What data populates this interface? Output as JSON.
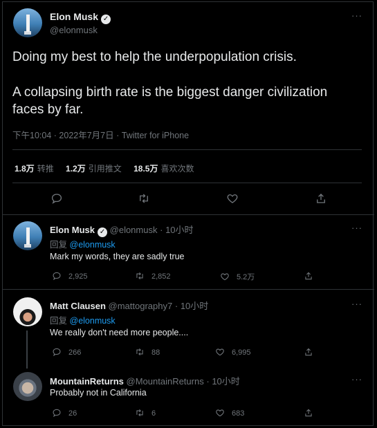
{
  "main_tweet": {
    "author_name": "Elon Musk",
    "author_handle": "@elonmusk",
    "text_line1": "Doing my best to help the underpopulation crisis.",
    "text_line2": "A collapsing birth rate is the biggest danger civilization",
    "text_line3": "faces by far.",
    "time": "下午10:04",
    "date": "2022年7月7日",
    "source": "Twitter for iPhone",
    "retweets_count": "1.8万",
    "retweets_label": "转推",
    "quotes_count": "1.2万",
    "quotes_label": "引用推文",
    "likes_count": "18.5万",
    "likes_label": "喜欢次数",
    "more": "···"
  },
  "replies": [
    {
      "name": "Elon Musk",
      "handle": "@elonmusk",
      "age": "10小时",
      "reply_prefix": "回复",
      "reply_to": "@elonmusk",
      "text": "Mark my words, they are sadly true",
      "replies": "2,925",
      "retweets": "2,852",
      "likes": "5.2万",
      "more": "···"
    },
    {
      "name": "Matt Clausen",
      "handle": "@mattography7",
      "age": "10小时",
      "reply_prefix": "回复",
      "reply_to": "@elonmusk",
      "text": "We really don't need more people....",
      "replies": "266",
      "retweets": "88",
      "likes": "6,995",
      "more": "···"
    },
    {
      "name": "MountainReturns",
      "handle": "@MountainReturns",
      "age": "10小时",
      "text": "Probably not in California",
      "replies": "26",
      "retweets": "6",
      "likes": "683",
      "more": "···"
    }
  ],
  "sep": "·",
  "icons": [
    "verified-badge-icon",
    "reply-icon",
    "retweet-icon",
    "like-icon",
    "share-icon",
    "more-icon"
  ]
}
